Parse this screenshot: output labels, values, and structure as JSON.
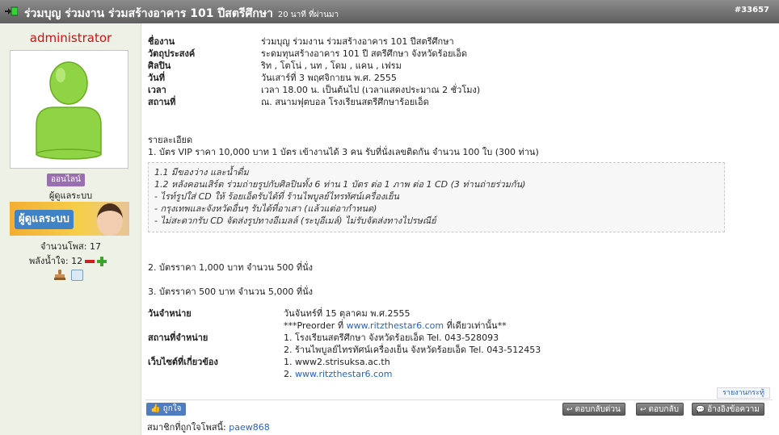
{
  "topbar": {
    "title": "ร่วมบุญ ร่วมงาน ร่วมสร้างอาคาร 101 ปีสตรีศึกษา",
    "time": "20 นาที ที่ผ่านมา",
    "post_id": "#33657"
  },
  "author": {
    "username": "administrator",
    "online_badge": "ออนไลน์",
    "role": "ผู้ดูแลระบบ",
    "banner_text": "ผู้ดูแลระบบ",
    "post_count": "จำนวนโพส: 17",
    "power_label": "พลังน้ำใจ: 12"
  },
  "info": [
    {
      "label": "ชื่องาน",
      "value": "ร่วมบุญ ร่วมงาน ร่วมสร้างอาคาร 101 ปีสตรีศึกษา"
    },
    {
      "label": "วัตถุประสงค์",
      "value": "ระดมทุนสร้างอาคาร 101 ปี สตรีศึกษา จังหวัดร้อยเอ็ด"
    },
    {
      "label": "ศิลปิน",
      "value": "ริท , โตโน่ , นท , โดม , แคน , เฟรม"
    },
    {
      "label": "วันที่",
      "value": "วันเสาร์ที่ 3 พฤศจิกายน พ.ศ. 2555"
    },
    {
      "label": "เวลา",
      "value": "เวลา 18.00 น. เป็นต้นไป (เวลาแสดงประมาณ 2 ชั่วโมง)"
    },
    {
      "label": "สถานที่",
      "value": "ณ. สนามฟุตบอล โรงเรียนสตรีศึกษาร้อยเอ็ด"
    }
  ],
  "details": {
    "heading": "รายละเอียด",
    "tier1": "1. บัตร VIP ราคา 10,000 บาท 1 บัตร เข้างานได้ 3 คน รับที่นั่งเลขติดกัน จำนวน 100 ใบ (300 ท่าน)",
    "quote": [
      "1.1 มีของว่าง และน้ำดื่ม",
      "1.2 หลังคอนเสิร์ต ร่วมถ่ายรูปกับศิลปินทั้ง 6 ท่าน 1 บัตร ต่อ 1 ภาพ ต่อ 1 CD (3 ท่านถ่ายร่วมกัน)",
      "- ไรท์รูปใส่ CD ให้ ร้อยเอ็ดรับได้ที่ ร้านไพบูลย์ไทรทัศน์เครื่องเย็น",
      "- กรุงเทพและจังหวัดอื่นๆ รับได้ที่อาเสา (แล้วแต่อากำหนด)",
      "- ไม่สะดวกรับ CD จัดส่งรูปทางอีเมลล์ (ระบุอีเมล์) ไม่รับจัดส่งทางไปรษณีย์"
    ],
    "tier2": "2. บัตรราคา 1,000 บาท จำนวน 500 ที่นั่ง",
    "tier3": "3. บัตรราคา 500 บาท จำนวน 5,000 ที่นั่ง"
  },
  "sale": {
    "date_label": "วันจำหน่าย",
    "date_value": "วันจันทร์ที่ 15 ตุลาคม พ.ศ.2555",
    "preorder_prefix": "***Preorder ที่",
    "preorder_link": "www.ritzthestar6.com",
    "preorder_suffix": "ที่เดียวเท่านั้น**",
    "place_label": "สถานที่จำหน่าย",
    "place_1": "1. โรงเรียนสตรีศึกษา จังหวัดร้อยเอ็ด Tel. 043-528093",
    "place_2": "2. ร้านไพบูลย์ไทรทัศน์เครื่องเย็น จังหวัดร้อยเอ็ด Tel. 043-512453",
    "web_label": "เว็บไซต์ที่เกี่ยวข้อง",
    "web_1": "1. www2.strisuksa.ac.th",
    "web_2_prefix": "2.",
    "web_2_link": "www.ritzthestar6.com"
  },
  "actions": {
    "report": "รายงานกระทู้",
    "like": "ถูกใจ",
    "quick_reply": "ตอบกลับด่วน",
    "reply": "ตอบกลับ",
    "quote": "อ้างอิงข้อความ"
  },
  "likers": {
    "prefix": "สมาชิกที่ถูกใจโพสนี้:",
    "user": "paew868"
  },
  "colors": {
    "header": "#6e6e6e",
    "sidebar": "#eef2e6",
    "username": "#d21111",
    "link": "#2b63b8",
    "avatar_green": "#8fd444"
  }
}
